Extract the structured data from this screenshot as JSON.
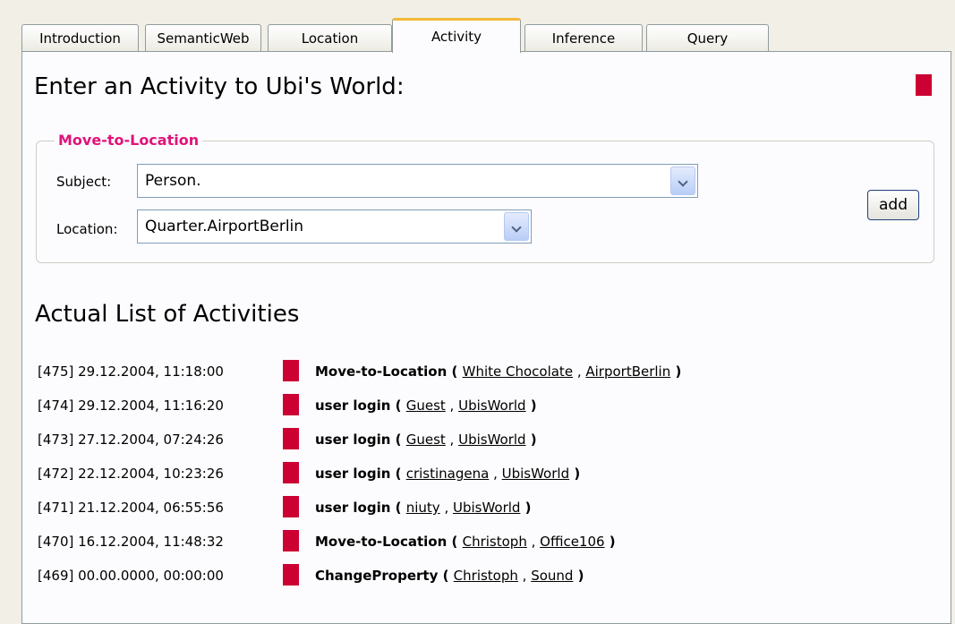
{
  "tabs": [
    "Introduction",
    "SemanticWeb",
    "Location",
    "Activity",
    "Inference",
    "Query"
  ],
  "active_tab": "Activity",
  "heading": "Enter an Activity to Ubi's World:",
  "marker_color": "#cc0033",
  "form": {
    "legend": "Move-to-Location",
    "subject_label": "Subject:",
    "subject_value": "Person.",
    "location_label": "Location:",
    "location_value": "Quarter.AirportBerlin",
    "add_label": "add"
  },
  "list_heading": "Actual List of Activities",
  "activities": [
    {
      "id": "[475]",
      "time": "29.12.2004, 11:18:00",
      "type": "Move-to-Location",
      "arg1": "White Chocolate",
      "arg2": "AirportBerlin"
    },
    {
      "id": "[474]",
      "time": "29.12.2004, 11:16:20",
      "type": "user login",
      "arg1": "Guest",
      "arg2": "UbisWorld"
    },
    {
      "id": "[473]",
      "time": "27.12.2004, 07:24:26",
      "type": "user login",
      "arg1": "Guest",
      "arg2": "UbisWorld"
    },
    {
      "id": "[472]",
      "time": "22.12.2004, 10:23:26",
      "type": "user login",
      "arg1": "cristinagena",
      "arg2": "UbisWorld"
    },
    {
      "id": "[471]",
      "time": "21.12.2004, 06:55:56",
      "type": "user login",
      "arg1": "niuty",
      "arg2": "UbisWorld"
    },
    {
      "id": "[470]",
      "time": "16.12.2004, 11:48:32",
      "type": "Move-to-Location",
      "arg1": "Christoph",
      "arg2": "Office106"
    },
    {
      "id": "[469]",
      "time": "00.00.0000, 00:00:00",
      "type": "ChangeProperty",
      "arg1": "Christoph",
      "arg2": "Sound"
    }
  ]
}
